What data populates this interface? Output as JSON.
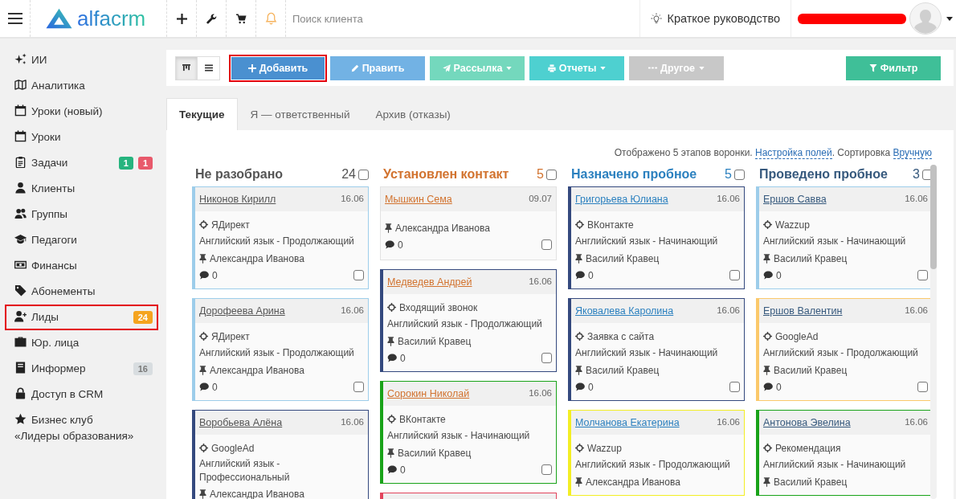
{
  "topbar": {
    "logo_text": "alfacrm",
    "search": {
      "placeholder": "Поиск клиента"
    },
    "guide_link": "Краткое руководство"
  },
  "sidebar": {
    "items": [
      {
        "label": "ИИ",
        "highlighted": false
      },
      {
        "label": "Аналитика",
        "highlighted": false
      },
      {
        "label": "Уроки (новый)",
        "highlighted": false
      },
      {
        "label": "Уроки",
        "highlighted": false
      },
      {
        "label": "Задачи",
        "highlighted": false,
        "badges": [
          {
            "text": "1",
            "color": "#26b47e"
          },
          {
            "text": "1",
            "color": "#e8596b"
          }
        ]
      },
      {
        "label": "Клиенты",
        "highlighted": false
      },
      {
        "label": "Группы",
        "highlighted": false
      },
      {
        "label": "Педагоги",
        "highlighted": false
      },
      {
        "label": "Финансы",
        "highlighted": false
      },
      {
        "label": "Абонементы",
        "highlighted": false
      },
      {
        "label": "Лиды",
        "highlighted": true,
        "badges": [
          {
            "text": "24",
            "color": "#f5a41f"
          }
        ]
      },
      {
        "label": "Юр. лица",
        "highlighted": false
      },
      {
        "label": "Информер",
        "highlighted": false,
        "badges": [
          {
            "text": "16",
            "color": "#d8dde0"
          }
        ]
      },
      {
        "label": "Доступ в CRM",
        "highlighted": false
      },
      {
        "label": "Бизнес клуб\n«Лидеры образования»",
        "highlighted": false
      }
    ]
  },
  "toolbar": {
    "view_toggle": [
      {
        "selected": true
      },
      {
        "selected": false
      }
    ],
    "actions": [
      {
        "label": "Добавить",
        "color": "#4a90d0",
        "dropdown": false,
        "highlighted": true
      },
      {
        "label": "Править",
        "color": "#72b2e4",
        "dropdown": false,
        "highlighted": false
      },
      {
        "label": "Рассылка",
        "color": "#74d8bd",
        "dropdown": true,
        "highlighted": false
      },
      {
        "label": "Отчеты",
        "color": "#4ed0d0",
        "dropdown": true,
        "highlighted": false
      },
      {
        "label": "Другое",
        "color": "#c8c8c8",
        "dropdown": true,
        "highlighted": false
      }
    ],
    "filter": {
      "label": "Фильтр",
      "color": "#3fbf98"
    }
  },
  "tabs": [
    {
      "label": "Текущие",
      "selected": true
    },
    {
      "label": "Я — ответственный",
      "selected": false
    },
    {
      "label": "Архив (отказы)",
      "selected": false
    }
  ],
  "board": {
    "info": [
      {
        "kind": "text",
        "text": "Отображено 5 этапов воронки. "
      },
      {
        "kind": "link",
        "text": "Настройка полей"
      },
      {
        "kind": "text",
        "text": ". Сортировка "
      },
      {
        "kind": "link",
        "text": "Вручную"
      }
    ],
    "columns": [
      {
        "title": "Не разобрано",
        "count": "24",
        "color": "#555555",
        "checked": false,
        "cards": [
          {
            "name": "Никонов Кирилл",
            "date": "16.06",
            "color": "#9dcdea",
            "source": "ЯДирект",
            "course": "Английский язык - Продолжающий",
            "teacher": "Александра Иванова",
            "comments": "0",
            "checked": false
          },
          {
            "name": "Дорофеева Арина",
            "date": "16.06",
            "color": "#9dcdea",
            "source": "ЯДирект",
            "course": "Английский язык - Продолжающий",
            "teacher": "Александра Иванова",
            "comments": "0",
            "checked": false
          },
          {
            "name": "Воробьева Алёна",
            "date": "16.06",
            "color": "#34497e",
            "source": "GoogleAd",
            "course": "Английский язык - Профессиональный",
            "teacher": "Александра Иванова"
          }
        ]
      },
      {
        "title": "Установлен контакт",
        "count": "5",
        "color": "#d2732f",
        "checked": false,
        "cards": [
          {
            "name": "Мышкин Сема",
            "date": "09.07",
            "teacher": "Александра Иванова",
            "comments": "0",
            "checked": false
          },
          {
            "name": "Медведев Андрей",
            "date": "16.06",
            "color": "#34497e",
            "source": "Входящий звонок",
            "course": "Английский язык - Продолжающий",
            "teacher": "Василий Кравец",
            "comments": "0",
            "checked": false
          },
          {
            "name": "Сорокин Николай",
            "date": "16.06",
            "color": "#19a319",
            "source": "ВКонтакте",
            "course": "Английский язык - Начинающий",
            "teacher": "Василий Кравец",
            "comments": "0",
            "checked": false
          },
          {
            "color": "#e2445c"
          }
        ]
      },
      {
        "title": "Назначено пробное",
        "count": "5",
        "color": "#2b80bf",
        "checked": false,
        "cards": [
          {
            "name": "Григорьева Юлиана",
            "date": "16.06",
            "color": "#34497e",
            "source": "ВКонтакте",
            "course": "Английский язык - Начинающий",
            "teacher": "Василий Кравец",
            "comments": "0",
            "checked": false
          },
          {
            "name": "Яковалева Каролина",
            "date": "16.06",
            "color": "#34497e",
            "source": "Заявка с сайта",
            "course": "Английский язык - Начинающий",
            "teacher": "Василий Кравец",
            "comments": "0",
            "checked": false
          },
          {
            "name": "Молчанова Екатерина",
            "date": "16.06",
            "color": "#f3ee24",
            "source": "Wazzup",
            "course": "Английский язык - Продолжающий",
            "teacher": "Александра Иванова"
          }
        ]
      },
      {
        "title": "Проведено пробное",
        "count": "3",
        "color": "#36597d",
        "checked": false,
        "cards": [
          {
            "name": "Ершов Савва",
            "date": "16.06",
            "color": "#9dcdea",
            "source": "Wazzup",
            "course": "Английский язык - Начинающий",
            "teacher": "Василий Кравец",
            "comments": "0",
            "checked": false
          },
          {
            "name": "Ершов Валентин",
            "date": "16.06",
            "color": "#fbc96b",
            "source": "GoogleAd",
            "course": "Английский язык - Продолжающий",
            "teacher": "Василий Кравец",
            "comments": "0",
            "checked": false
          },
          {
            "name": "Антонова Эвелина",
            "date": "16.06",
            "color": "#19a319",
            "source": "Рекомендация",
            "course": "Английский язык - Начинающий",
            "teacher": "Василий Кравец"
          }
        ]
      }
    ]
  }
}
